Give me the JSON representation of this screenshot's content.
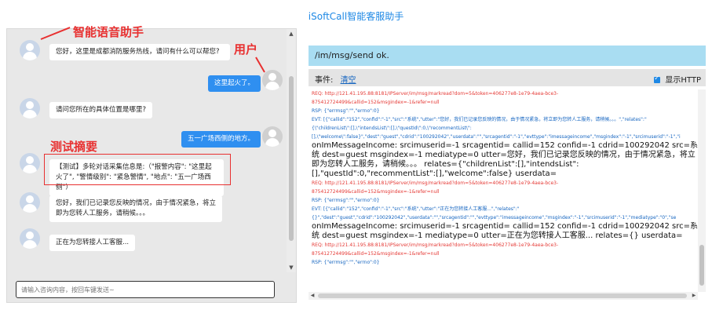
{
  "app": {
    "title": "iSoftCall智能客服助手"
  },
  "annotations": {
    "bot_label": "智能语音助手",
    "user_label": "用户",
    "summary_label": "测试摘要"
  },
  "chat": {
    "messages": [
      {
        "role": "bot",
        "text": "您好，这里是成都消防服务热线，请问有什么可以帮您?"
      },
      {
        "role": "user",
        "text": "这里起火了。"
      },
      {
        "role": "bot",
        "text": "请问您所在的具体位置是哪里?"
      },
      {
        "role": "user",
        "text": "五一广场西侧的地方。"
      },
      {
        "role": "bot",
        "text": "【测试】多轮对话采集信息是:（\"报警内容\": \"这里起火了\", \"警情级别\": \"紧急警情\", \"地点\": \"五一广场西侧\"）"
      },
      {
        "role": "bot",
        "text": "您好，我们已记录您反映的情况，由于情况紧急，将立即为您转人工服务，请稍候。。。"
      },
      {
        "role": "bot",
        "text": "正在为您转接人工客服..."
      }
    ],
    "input_placeholder": "请输入咨询内容，按回车键发送~"
  },
  "debug": {
    "url": "/im/msg/send ok.",
    "event_label": "事件:",
    "clear_label": "清空",
    "show_http_label": "显示HTTP",
    "show_http_checked": true,
    "log": [
      {
        "type": "req",
        "text": "REQ: http://121.41.195.88:8181/IPServer/im/msg/markread?dom=5&token=406277e8-1e79-4aea-bce3-"
      },
      {
        "type": "req",
        "text": "875412724499&callid=152&msgindex=-1&refer=null"
      },
      {
        "type": "rsp",
        "text": "RSP: {\"errmsg\":\"\",\"errno\":0}"
      },
      {
        "type": "evt",
        "text": "EVT: [{\"callid\":\"152\",\"confid\":\"-1\",\"src\":\"系统\",\"utter\":\"您好，我们已记录您反映的情况，由于情况紧急，将立即为您转人工服务，请稍候。。。\",\"relates\":\""
      },
      {
        "type": "evt",
        "text": "{\\\"childrenList\\\":[],\\\"intendsList\\\":[],\\\"questId\\\":0,\\\"recommentList\\\":"
      },
      {
        "type": "evt",
        "text": "[],\\\"welcome\\\":false}\",\"dest\":\"guest\",\"cdrid\":\"100292042\",\"userdata\":\"\",\"srcagentid\":\"-1\",\"evttype\":\"imessageincome\",\"msgindex\":\"-1\",\"srcimuserid\":\"-1\",\"i"
      },
      {
        "type": "main",
        "text": "onImMessageIncome: srcimuserid=-1 srcagentid= callid=152 confid=-1 cdrid=100292042 src=系统 dest=guest msgindex=-1 mediatype=0 utter=您好，我们已记录您反映的情况，由于情况紧急，将立即为您转人工服务，请稍候。。。 relates={\"childrenList\":[],\"intendsList\":[],\"questId\":0,\"recommentList\":[],\"welcome\":false} userdata="
      },
      {
        "type": "req",
        "text": "REQ: http://121.41.195.88:8181/IPServer/im/msg/markread?dom=5&token=406277e8-1e79-4aea-bce3-"
      },
      {
        "type": "req",
        "text": "875412724499&callid=152&msgindex=-1&refer=null"
      },
      {
        "type": "rsp",
        "text": "RSP: {\"errmsg\":\"\",\"errno\":0}"
      },
      {
        "type": "evt",
        "text": "EVT: [{\"callid\":\"152\",\"confid\":\"-1\",\"src\":\"系统\",\"utter\":\"正在为您转接人工客服...\",\"relates\":\""
      },
      {
        "type": "evt",
        "text": "{}\",\"dest\":\"guest\",\"cdrid\":\"100292042\",\"userdata\":\"\",\"srcagentid\":\"\",\"evttype\":\"imessageincome\",\"msgindex\":\"-1\",\"srcimuserid\":\"-1\",\"mediatype\":\"0\",\"se"
      },
      {
        "type": "main",
        "text": "onImMessageIncome: srcimuserid=-1 srcagentid= callid=152 confid=-1 cdrid=100292042 src=系统 dest=guest msgindex=-1 mediatype=0 utter=正在为您转接人工客服... relates={} userdata="
      },
      {
        "type": "req",
        "text": "REQ: http://121.41.195.88:8181/IPServer/im/msg/markread?dom=5&token=406277e8-1e79-4aea-bce3-"
      },
      {
        "type": "req",
        "text": "875412724499&callid=152&msgindex=-1&refer=null"
      },
      {
        "type": "rsp",
        "text": "RSP: {\"errmsg\":\"\",\"errno\":0}"
      }
    ]
  },
  "colors": {
    "accent": "#1e88e5",
    "annotation": "#e83030",
    "user_bubble": "#2f8ff0",
    "url_bar": "#a9ddf2"
  }
}
